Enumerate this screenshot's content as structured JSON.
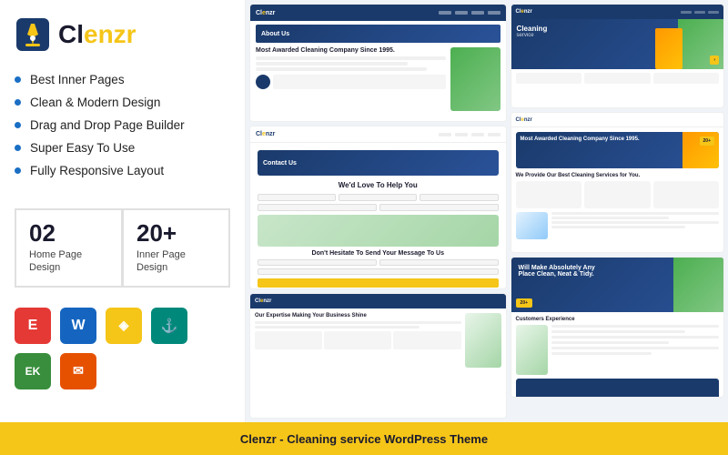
{
  "logo": {
    "name": "Clenzr",
    "name_prefix": "Cl",
    "name_suffix": "enzr"
  },
  "features": [
    "Best Inner Pages",
    "Clean & Modern Design",
    "Drag and Drop Page Builder",
    "Super Easy To Use",
    "Fully Responsive Layout"
  ],
  "stats": [
    {
      "number": "02",
      "label1": "Home Page",
      "label2": "Design"
    },
    {
      "number": "20+",
      "label1": "Inner Page",
      "label2": "Design"
    }
  ],
  "badges": [
    {
      "name": "elementor",
      "symbol": "E",
      "bg": "#e53935"
    },
    {
      "name": "wordpress",
      "symbol": "W",
      "bg": "#1565c0"
    },
    {
      "name": "box",
      "symbol": "◈",
      "bg": "#f5c518"
    },
    {
      "name": "anchor",
      "symbol": "⚓",
      "bg": "#00897b"
    },
    {
      "name": "elementorkit",
      "symbol": "EK",
      "bg": "#388e3c"
    },
    {
      "name": "mailchimp",
      "symbol": "✉",
      "bg": "#e65100"
    }
  ],
  "bottom_bar": {
    "text": "Clenzr - Cleaning service WordPress Theme"
  },
  "previews": {
    "col1": {
      "about_title": "About Us",
      "contact_title": "Contact Us",
      "help_title": "We'd Love To Help You",
      "send_title": "Don't Hesitate To Send Your Message To Us",
      "expertise_title": "Our Expertise Making Your Business Shine"
    },
    "col2": {
      "hero_title": "Cleaning",
      "company_title": "Most Awarded Cleaning Company Since 1995.",
      "services_title": "We Provide Our Best Cleaning Services for You.",
      "customers_title": "Customers Experience",
      "badge_number": "20+",
      "badge_text": "Most awarded cleaning company since 1995."
    }
  }
}
